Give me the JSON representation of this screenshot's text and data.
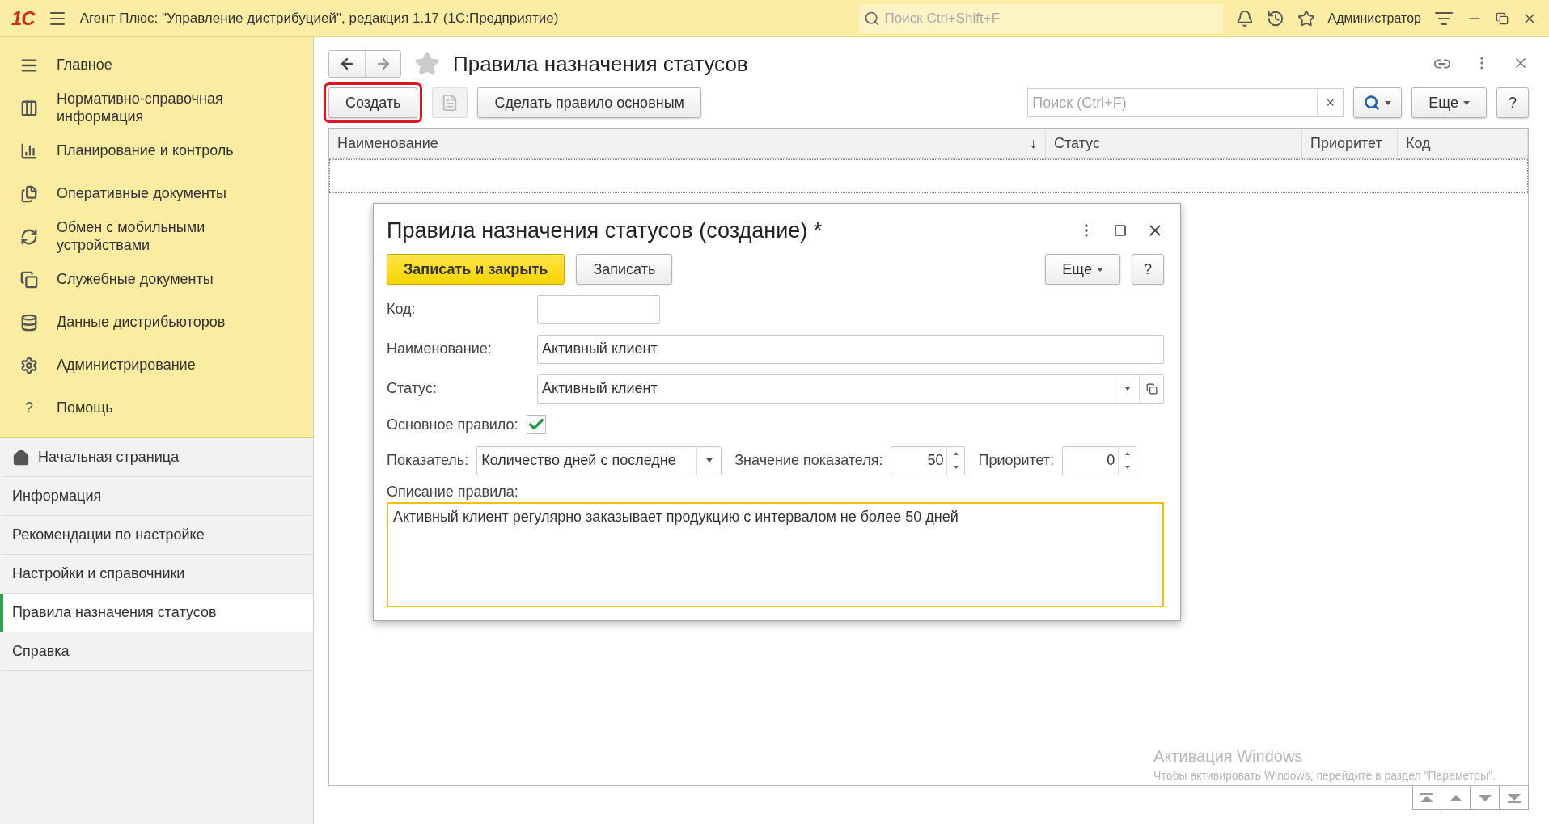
{
  "titlebar": {
    "logo": "1С",
    "title": "Агент Плюс: \"Управление дистрибуцией\", редакция 1.17  (1С:Предприятие)",
    "search_placeholder": "Поиск Ctrl+Shift+F",
    "user": "Администратор"
  },
  "sidebar": {
    "sections": [
      {
        "kind": "list",
        "label": "Главное"
      },
      {
        "kind": "columns",
        "label": "Нормативно-справочная информация"
      },
      {
        "kind": "chart",
        "label": "Планирование и контроль"
      },
      {
        "kind": "docs",
        "label": "Оперативные документы"
      },
      {
        "kind": "sync",
        "label": "Обмен с мобильными устройствами"
      },
      {
        "kind": "service",
        "label": "Служебные документы"
      },
      {
        "kind": "data",
        "label": "Данные дистрибьюторов"
      },
      {
        "kind": "gear",
        "label": "Администрирование"
      },
      {
        "kind": "help",
        "icon_text": "?",
        "label": "Помощь"
      }
    ],
    "open_items": [
      {
        "kind": "home",
        "label": "Начальная страница",
        "selected": false
      },
      {
        "kind": "plain",
        "label": "Информация",
        "selected": false
      },
      {
        "kind": "plain",
        "label": "Рекомендации по настройке",
        "selected": false
      },
      {
        "kind": "plain",
        "label": "Настройки и справочники",
        "selected": false
      },
      {
        "kind": "plain",
        "label": "Правила назначения статусов",
        "selected": true
      },
      {
        "kind": "plain",
        "label": "Справка",
        "selected": false
      }
    ]
  },
  "page": {
    "title": "Правила назначения статусов",
    "toolbar": {
      "create": "Создать",
      "create_highlighted": true,
      "make_main": "Сделать правило основным",
      "search_placeholder": "Поиск (Ctrl+F)",
      "clear": "×",
      "more": "Еще",
      "help": "?"
    },
    "table": {
      "columns": [
        {
          "label": "Наименование",
          "sort_mark": "↓"
        },
        {
          "label": "Статус"
        },
        {
          "label": "Приоритет"
        },
        {
          "label": "Код"
        }
      ]
    }
  },
  "dialog": {
    "title": "Правила назначения статусов (создание) *",
    "save_close": "Записать и закрыть",
    "save": "Записать",
    "more": "Еще",
    "help": "?",
    "code_label": "Код:",
    "name_label": "Наименование:",
    "name_value": "Активный клиент",
    "status_label": "Статус:",
    "status_value": "Активный клиент",
    "main_rule_label": "Основное правило:",
    "main_rule_checked": true,
    "indicator_label": "Показатель:",
    "indicator_value": "Количество дней с последне",
    "indicator_amount_label": "Значение показателя:",
    "indicator_amount": "50",
    "priority_label": "Приоритет:",
    "priority_value": "0",
    "description_label": "Описание правила:",
    "description": "Активный клиент регулярно заказывает продукцию с интервалом не более 50 дней"
  },
  "os_notice": {
    "title": "Активация Windows",
    "text": "Чтобы активировать Windows, перейдите в раздел \"Параметры\"."
  }
}
